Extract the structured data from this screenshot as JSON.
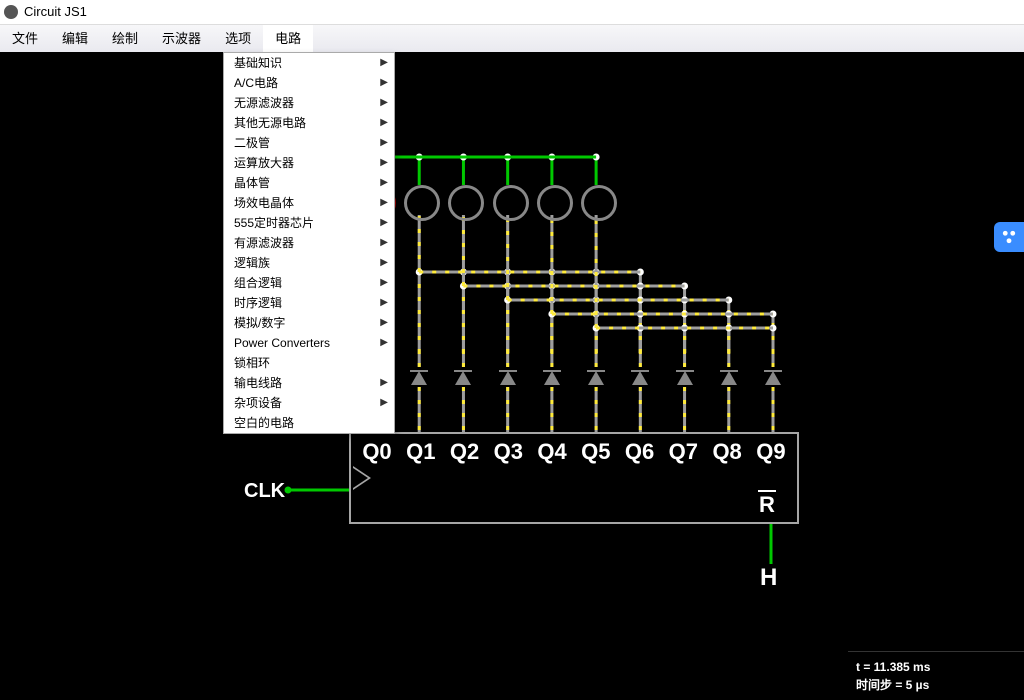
{
  "app": {
    "title": "Circuit JS1"
  },
  "menubar": {
    "items": [
      "文件",
      "编辑",
      "绘制",
      "示波器",
      "选项",
      "电路"
    ],
    "open_index": 5
  },
  "dropdown": {
    "items": [
      {
        "label": "基础知识",
        "submenu": true
      },
      {
        "label": "A/C电路",
        "submenu": true
      },
      {
        "label": "无源滤波器",
        "submenu": true
      },
      {
        "label": "其他无源电路",
        "submenu": true
      },
      {
        "label": "二极管",
        "submenu": true
      },
      {
        "label": "运算放大器",
        "submenu": true
      },
      {
        "label": "晶体管",
        "submenu": true
      },
      {
        "label": "场效电晶体",
        "submenu": true
      },
      {
        "label": "555定时器芯片",
        "submenu": true
      },
      {
        "label": "有源滤波器",
        "submenu": true
      },
      {
        "label": "逻辑族",
        "submenu": true
      },
      {
        "label": "组合逻辑",
        "submenu": true
      },
      {
        "label": "时序逻辑",
        "submenu": true
      },
      {
        "label": "模拟/数字",
        "submenu": true
      },
      {
        "label": "Power Converters",
        "submenu": true
      },
      {
        "label": "锁相环",
        "submenu": false
      },
      {
        "label": "输电线路",
        "submenu": true
      },
      {
        "label": "杂项设备",
        "submenu": true
      },
      {
        "label": "空白的电路",
        "submenu": false
      }
    ]
  },
  "circuit": {
    "clk_label": "CLK",
    "high_label": "H",
    "reset_label": "R",
    "counter_pins": [
      "Q0",
      "Q1",
      "Q2",
      "Q3",
      "Q4",
      "Q5",
      "Q6",
      "Q7",
      "Q8",
      "Q9"
    ],
    "bulbs_active": [
      true,
      false,
      false,
      false,
      false,
      false
    ]
  },
  "status": {
    "time": "t = 11.385 ms",
    "step": "时间步 = 5 µs"
  },
  "sidewidget": {
    "icon": "cluster-icon"
  }
}
